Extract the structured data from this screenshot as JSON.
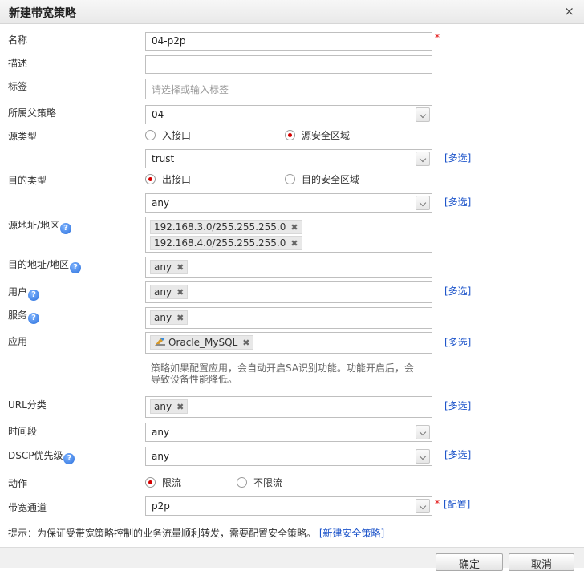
{
  "dialog": {
    "title": "新建带宽策略",
    "close": "×"
  },
  "fields": {
    "name": {
      "label": "名称",
      "value": "04-p2p",
      "required": "*"
    },
    "desc": {
      "label": "描述",
      "value": ""
    },
    "tags": {
      "label": "标签",
      "placeholder": "请选择或输入标签"
    },
    "parent": {
      "label": "所属父策略",
      "value": "04"
    },
    "src_type": {
      "label": "源类型",
      "opt1": "入接口",
      "opt2": "源安全区域",
      "selected": "源安全区域"
    },
    "src_zone": {
      "value": "trust",
      "multi": "[多选]"
    },
    "dst_type": {
      "label": "目的类型",
      "opt1": "出接口",
      "opt2": "目的安全区域",
      "selected": "出接口"
    },
    "dst_if": {
      "value": "any",
      "multi": "[多选]"
    },
    "src_addr": {
      "label": "源地址/地区",
      "tags": [
        "192.168.3.0/255.255.255.0",
        "192.168.4.0/255.255.255.0"
      ]
    },
    "dst_addr": {
      "label": "目的地址/地区",
      "tags": [
        "any"
      ]
    },
    "user": {
      "label": "用户",
      "tags": [
        "any"
      ],
      "multi": "[多选]"
    },
    "service": {
      "label": "服务",
      "tags": [
        "any"
      ]
    },
    "app": {
      "label": "应用",
      "tags": [
        "Oracle_MySQL"
      ],
      "multi": "[多选]",
      "note": "策略如果配置应用，会自动开启SA识别功能。功能开启后，会导致设备性能降低。"
    },
    "url": {
      "label": "URL分类",
      "tags": [
        "any"
      ],
      "multi": "[多选]"
    },
    "time": {
      "label": "时间段",
      "value": "any"
    },
    "dscp": {
      "label": "DSCP优先级",
      "value": "any",
      "multi": "[多选]"
    },
    "action": {
      "label": "动作",
      "opt1": "限流",
      "opt2": "不限流",
      "selected": "限流"
    },
    "channel": {
      "label": "带宽通道",
      "value": "p2p",
      "required": "*",
      "config": "[配置]"
    }
  },
  "tip": {
    "text": "提示：为保证受带宽策略控制的业务流量顺利转发，需要配置安全策略。",
    "link": "[新建安全策略]"
  },
  "buttons": {
    "ok": "确定",
    "cancel": "取消"
  },
  "help_icon": "?",
  "tag_remove_icon": "✖",
  "colors": {
    "required": "#e00000",
    "link": "#1a52c9",
    "radio_selected": "#d40000"
  }
}
